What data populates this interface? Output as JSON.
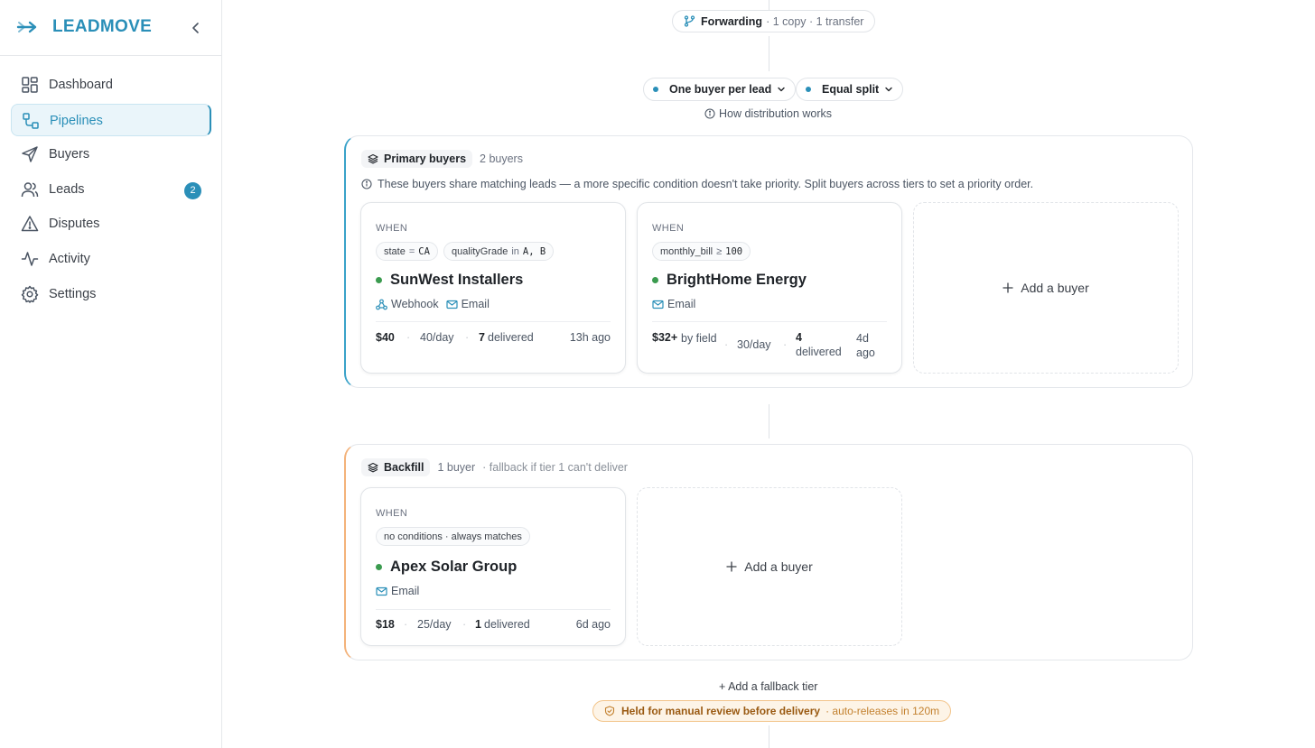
{
  "app": {
    "name": "LEADMOVE",
    "logo_icon": "arrow-logo-icon",
    "accent": "#2a8fb8"
  },
  "sidebar": {
    "items": [
      {
        "label": "Dashboard",
        "icon": "dashboard-icon",
        "active": false
      },
      {
        "label": "Pipelines",
        "icon": "pipelines-icon",
        "active": true
      },
      {
        "label": "Buyers",
        "icon": "send-icon",
        "active": false
      },
      {
        "label": "Leads",
        "icon": "users-icon",
        "active": false,
        "badge": "2"
      },
      {
        "label": "Disputes",
        "icon": "warning-icon",
        "active": false
      },
      {
        "label": "Activity",
        "icon": "activity-icon",
        "active": false
      },
      {
        "label": "Settings",
        "icon": "gear-icon",
        "active": false
      }
    ]
  },
  "flow": {
    "forwarding": {
      "title": "Forwarding",
      "subtitle": "· 1 copy · 1 transfer"
    },
    "distribution_mode": "One buyer per lead",
    "split_mode": "Equal split",
    "how_link": "How distribution works"
  },
  "tiers": [
    {
      "tag": "Primary buyers",
      "count": "2 buyers",
      "note": "",
      "info": "These buyers share matching leads — a more specific condition doesn't take priority. Split buyers across tiers to set a priority order.",
      "accent": "#3aa2c9",
      "buyers": [
        {
          "when": "WHEN",
          "conditions": [
            {
              "field": "state",
              "op": "=",
              "value": "CA"
            },
            {
              "field": "qualityGrade",
              "op": "in",
              "value": "A, B"
            }
          ],
          "name": "SunWest Installers",
          "channels": [
            {
              "label": "Webhook",
              "icon": "webhook-icon"
            },
            {
              "label": "Email",
              "icon": "mail-icon"
            }
          ],
          "price": "$40",
          "cap": "40/day",
          "delivered_count": "7",
          "delivered_label": "delivered",
          "last": "13h ago"
        },
        {
          "when": "WHEN",
          "conditions": [
            {
              "field": "monthly_bill",
              "op": "≥",
              "value": "100"
            }
          ],
          "name": "BrightHome Energy",
          "channels": [
            {
              "label": "Email",
              "icon": "mail-icon"
            }
          ],
          "price": "$32+",
          "price_suffix": "by field",
          "cap": "30/day",
          "delivered_count": "4",
          "delivered_label": "delivered",
          "last": "4d ago"
        }
      ],
      "add_label": "Add a buyer"
    },
    {
      "tag": "Backfill",
      "count": "1 buyer",
      "note": "· fallback if tier 1 can't deliver",
      "accent": "#f3b27a",
      "buyers": [
        {
          "when": "WHEN",
          "conditions_text": "no conditions · always matches",
          "name": "Apex Solar Group",
          "channels": [
            {
              "label": "Email",
              "icon": "mail-icon"
            }
          ],
          "price": "$18",
          "cap": "25/day",
          "delivered_count": "1",
          "delivered_label": "delivered",
          "last": "6d ago"
        }
      ],
      "add_label": "Add a buyer"
    }
  ],
  "footer": {
    "add_tier": "+ Add a fallback tier",
    "review_title": "Held for manual review before delivery",
    "review_sub": "· auto-releases in 120m"
  }
}
